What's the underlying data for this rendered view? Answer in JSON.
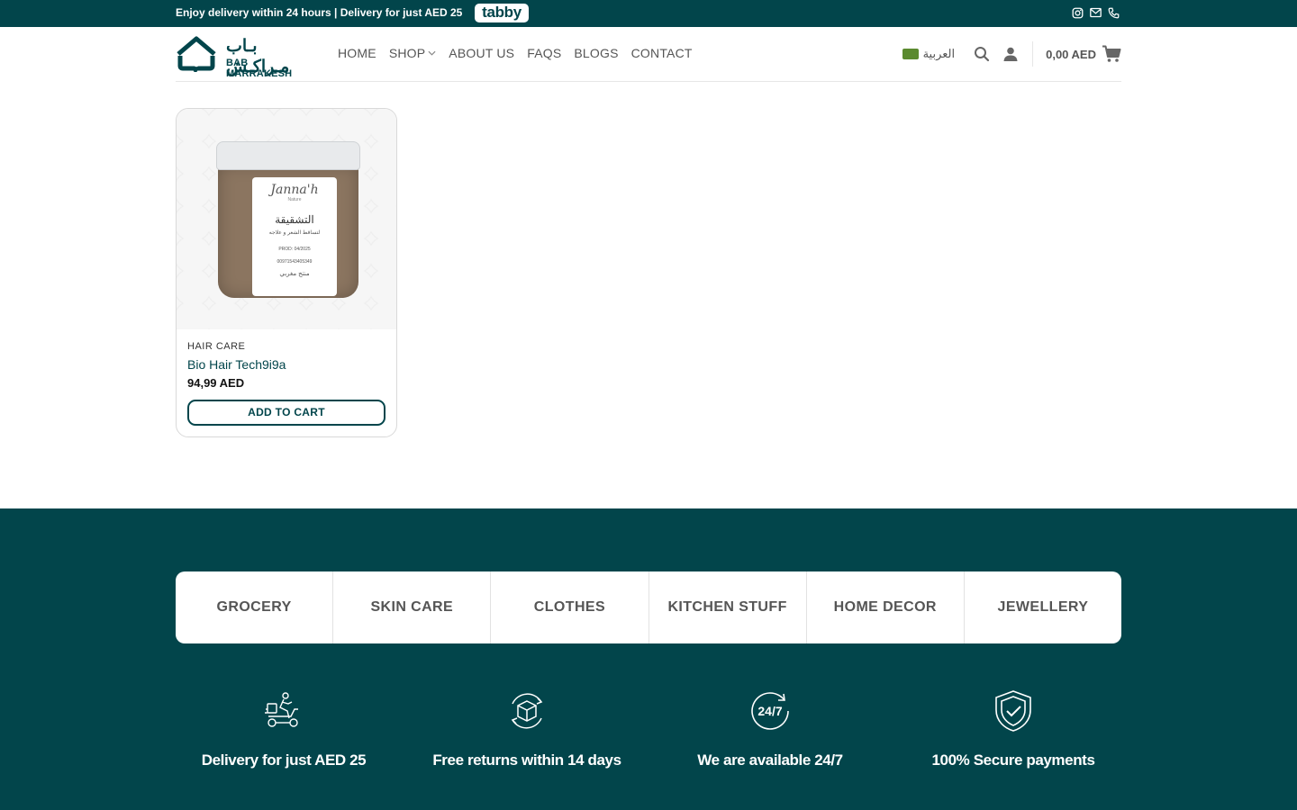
{
  "topbar": {
    "message": "Enjoy delivery within 24 hours | Delivery for just AED 25",
    "tabby": "tabby",
    "icons": [
      "instagram-icon",
      "mail-icon",
      "phone-icon"
    ]
  },
  "logo": {
    "arabic": "بـاب مـراكـش",
    "english": "BAB MARRAKESH"
  },
  "nav": {
    "items": [
      "HOME",
      "SHOP",
      "ABOUT US",
      "FAQS",
      "BLOGS",
      "CONTACT"
    ]
  },
  "header_right": {
    "language": "العربية",
    "cart_total": "0,00 AED"
  },
  "product": {
    "category": "HAIR CARE",
    "name": "Bio Hair Tech9i9a",
    "price": "94,99 AED",
    "button": "ADD TO CART",
    "image_label": {
      "brand": "Janna'h",
      "tagline": "Nature",
      "title": "التشقيقة",
      "subtitle": "لتساقط الشعر و علاجه",
      "prod": "PROD: 04/2025",
      "phone": "00971543405349",
      "origin": "منتج مغربي"
    }
  },
  "footer": {
    "categories": [
      "GROCERY",
      "SKIN CARE",
      "CLOTHES",
      "KITCHEN STUFF",
      "HOME DECOR",
      "JEWELLERY"
    ],
    "features": [
      {
        "icon": "delivery-scooter-icon",
        "text": "Delivery for just AED 25"
      },
      {
        "icon": "return-box-icon",
        "text": "Free returns within 14 days"
      },
      {
        "icon": "24-7-icon",
        "text": "We are available 24/7"
      },
      {
        "icon": "secure-shield-icon",
        "text": "100% Secure payments"
      }
    ]
  },
  "colors": {
    "brand": "#02454b",
    "text": "#555555",
    "white": "#ffffff"
  }
}
